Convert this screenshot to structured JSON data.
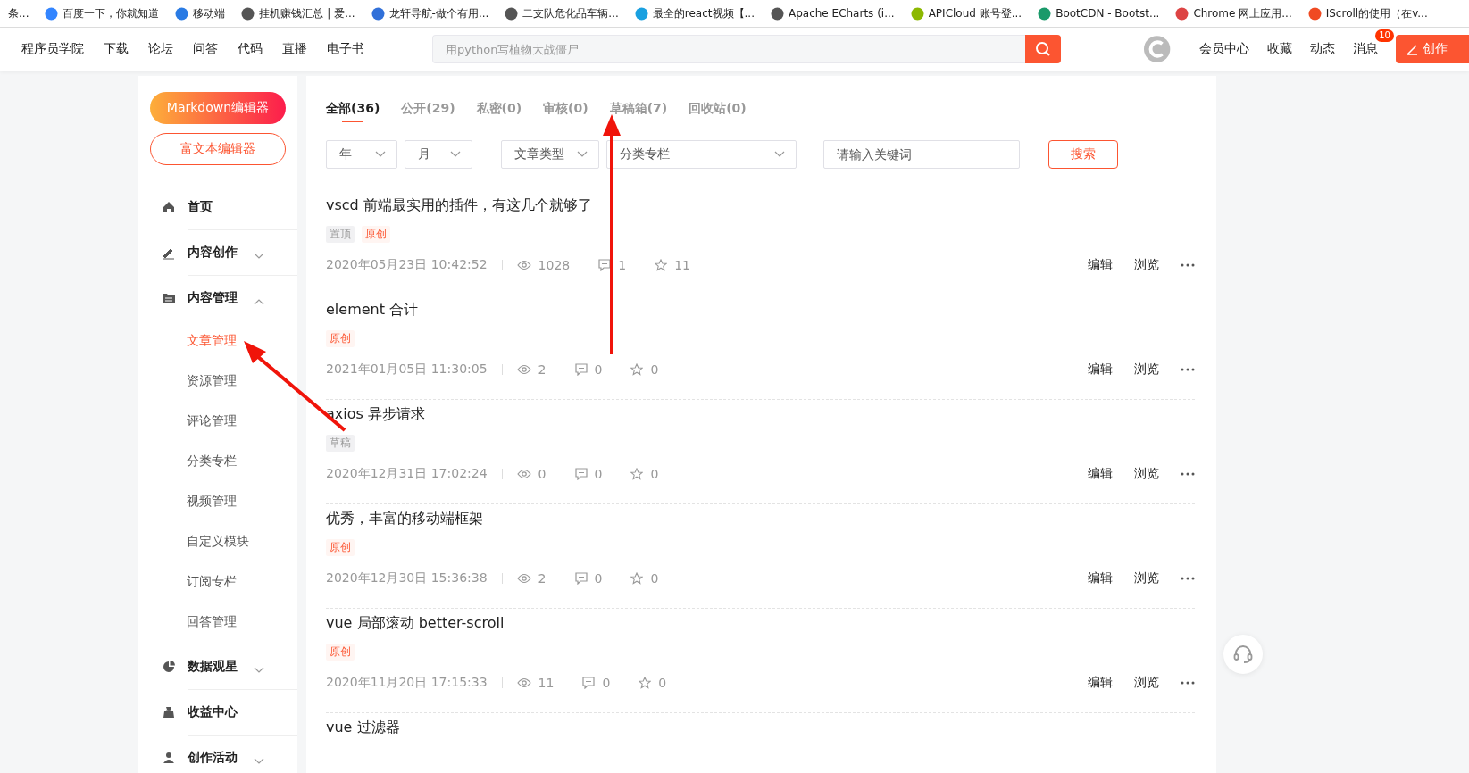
{
  "bookmarks": [
    {
      "label": "条..."
    },
    {
      "label": "百度一下，你就知道"
    },
    {
      "label": "移动端"
    },
    {
      "label": "挂机赚钱汇总 | 爱..."
    },
    {
      "label": "龙轩导航-做个有用..."
    },
    {
      "label": "二支队危化品车辆..."
    },
    {
      "label": "最全的react视频【..."
    },
    {
      "label": "Apache ECharts (i..."
    },
    {
      "label": "APICloud 账号登..."
    },
    {
      "label": "BootCDN - Bootst..."
    },
    {
      "label": "Chrome 网上应用..."
    },
    {
      "label": "IScroll的使用（在v..."
    }
  ],
  "nav": {
    "links": [
      "程序员学院",
      "下载",
      "论坛",
      "问答",
      "代码",
      "直播",
      "电子书"
    ],
    "search": {
      "placeholder": "用python写植物大战僵尸"
    },
    "right_links": [
      "会员中心",
      "收藏",
      "动态",
      "消息"
    ],
    "message_badge": "10",
    "create_button": "创作"
  },
  "sidebar": {
    "markdown_button": "Markdown编辑器",
    "richtext_button": "富文本编辑器",
    "items": [
      {
        "label": "首页"
      },
      {
        "label": "内容创作",
        "expanded": false
      },
      {
        "label": "内容管理",
        "expanded": true,
        "children": [
          {
            "label": "文章管理",
            "selected": true
          },
          {
            "label": "资源管理",
            "selected": false
          },
          {
            "label": "评论管理",
            "selected": false
          },
          {
            "label": "分类专栏",
            "selected": false
          },
          {
            "label": "视频管理",
            "selected": false
          },
          {
            "label": "自定义模块",
            "selected": false
          },
          {
            "label": "订阅专栏",
            "selected": false
          },
          {
            "label": "回答管理",
            "selected": false
          }
        ]
      },
      {
        "label": "数据观星",
        "expanded": false
      },
      {
        "label": "收益中心"
      },
      {
        "label": "创作活动",
        "expanded": false
      }
    ]
  },
  "tabs": [
    {
      "label": "全部(36)",
      "selected": true
    },
    {
      "label": "公开(29)",
      "selected": false
    },
    {
      "label": "私密(0)",
      "selected": false
    },
    {
      "label": "审核(0)",
      "selected": false
    },
    {
      "label": "草稿箱(7)",
      "selected": false
    },
    {
      "label": "回收站(0)",
      "selected": false
    }
  ],
  "filters": {
    "selects": [
      {
        "value": "年"
      },
      {
        "value": "月"
      },
      {
        "value": "文章类型"
      },
      {
        "value": "分类专栏"
      }
    ],
    "keyword": {
      "placeholder": "请输入关键词"
    },
    "search_button": "搜索"
  },
  "articles": [
    {
      "title": "vscd 前端最实用的插件，有这几个就够了",
      "tags": [
        {
          "label": "置顶",
          "kind": "top"
        },
        {
          "label": "原创",
          "kind": "original"
        }
      ],
      "date": "2020年05月23日 10:42:52",
      "views": "1028",
      "comments": "1",
      "favorites": "11",
      "actions": [
        "编辑",
        "浏览"
      ]
    },
    {
      "title": "element 合计",
      "tags": [
        {
          "label": "原创",
          "kind": "original"
        }
      ],
      "date": "2021年01月05日 11:30:05",
      "views": "2",
      "comments": "0",
      "favorites": "0",
      "actions": [
        "编辑",
        "浏览"
      ]
    },
    {
      "title": "axios 异步请求",
      "tags": [
        {
          "label": "草稿",
          "kind": "draft"
        }
      ],
      "date": "2020年12月31日 17:02:24",
      "views": "0",
      "comments": "0",
      "favorites": "0",
      "actions": [
        "编辑",
        "浏览"
      ]
    },
    {
      "title": "优秀，丰富的移动端框架",
      "tags": [
        {
          "label": "原创",
          "kind": "original"
        }
      ],
      "date": "2020年12月30日 15:36:38",
      "views": "2",
      "comments": "0",
      "favorites": "0",
      "actions": [
        "编辑",
        "浏览"
      ]
    },
    {
      "title": "vue 局部滚动 better-scroll",
      "tags": [
        {
          "label": "原创",
          "kind": "original"
        }
      ],
      "date": "2020年11月20日 17:15:33",
      "views": "11",
      "comments": "0",
      "favorites": "0",
      "actions": [
        "编辑",
        "浏览"
      ]
    },
    {
      "title": "vue 过滤器"
    }
  ]
}
